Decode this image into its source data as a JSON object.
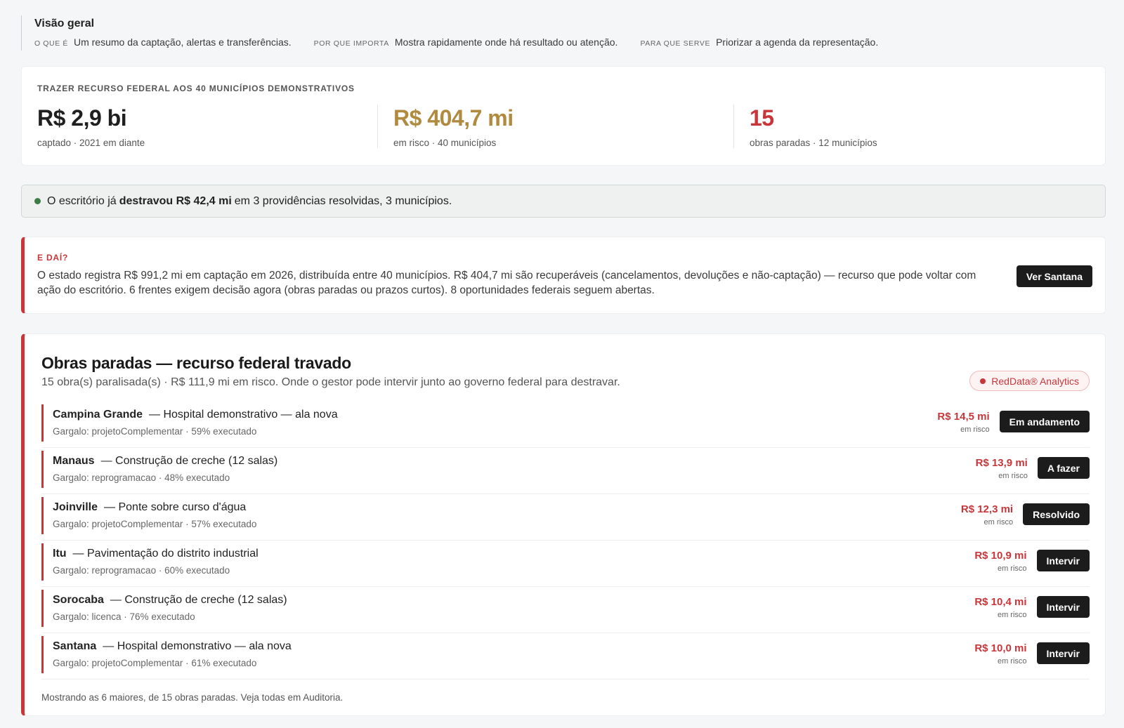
{
  "overview": {
    "title": "Visão geral",
    "pairs": [
      {
        "k": "O que é",
        "v": "Um resumo da captação, alertas e transferências."
      },
      {
        "k": "Por que importa",
        "v": "Mostra rapidamente onde há resultado ou atenção."
      },
      {
        "k": "Para que serve",
        "v": "Priorizar a agenda da representação."
      }
    ]
  },
  "kpis": {
    "eyebrow": "Trazer recurso federal aos 40 municípios demonstrativos",
    "items": [
      {
        "value": "R$ 2,9 bi",
        "sub": "captado · 2021 em diante",
        "color": "#1f1f1f"
      },
      {
        "value": "R$ 404,7 mi",
        "sub": "em risco · 40 municípios",
        "color": "#b08a3e"
      },
      {
        "value": "15",
        "sub": "obras paradas · 12 municípios",
        "color": "#c8363a"
      }
    ]
  },
  "banner": {
    "pre": "O escritório já",
    "bold": "destravou R$ 42,4 mi",
    "post": "em 3 providências resolvidas, 3 municípios."
  },
  "edai": {
    "eyebrow": "E daí?",
    "text": "O estado registra R$ 991,2 mi em captação em 2026, distribuída entre 40 municípios. R$ 404,7 mi são recuperáveis (cancelamentos, devoluções e não-captação) — recurso que pode voltar com ação do escritório. 6 frentes exigem decisão agora (obras paradas ou prazos curtos). 8 oportunidades federais seguem abertas.",
    "button": "Ver Santana"
  },
  "obras": {
    "title": "Obras paradas — recurso federal travado",
    "subtitle": "15 obra(s) paralisada(s) · R$ 111,9 mi em risco. Onde o gestor pode intervir junto ao governo federal para destravar.",
    "badge": "RedData® Analytics",
    "rows": [
      {
        "city": "Campina Grande",
        "desc": "— Hospital demonstrativo — ala nova",
        "meta": "Gargalo: projetoComplementar · 59% executado",
        "amount": "R$ 14,5 mi",
        "amount_sub": "em risco",
        "action": "Em andamento"
      },
      {
        "city": "Manaus",
        "desc": "— Construção de creche (12 salas)",
        "meta": "Gargalo: reprogramacao · 48% executado",
        "amount": "R$ 13,9 mi",
        "amount_sub": "em risco",
        "action": "A fazer"
      },
      {
        "city": "Joinville",
        "desc": "— Ponte sobre curso d'água",
        "meta": "Gargalo: projetoComplementar · 57% executado",
        "amount": "R$ 12,3 mi",
        "amount_sub": "em risco",
        "action": "Resolvido"
      },
      {
        "city": "Itu",
        "desc": "— Pavimentação do distrito industrial",
        "meta": "Gargalo: reprogramacao · 60% executado",
        "amount": "R$ 10,9 mi",
        "amount_sub": "em risco",
        "action": "Intervir"
      },
      {
        "city": "Sorocaba",
        "desc": "— Construção de creche (12 salas)",
        "meta": "Gargalo: licenca · 76% executado",
        "amount": "R$ 10,4 mi",
        "amount_sub": "em risco",
        "action": "Intervir"
      },
      {
        "city": "Santana",
        "desc": "— Hospital demonstrativo — ala nova",
        "meta": "Gargalo: projetoComplementar · 61% executado",
        "amount": "R$ 10,0 mi",
        "amount_sub": "em risco",
        "action": "Intervir"
      }
    ],
    "footer": "Mostrando as 6 maiores, de 15 obras paradas. Veja todas em Auditoria."
  }
}
